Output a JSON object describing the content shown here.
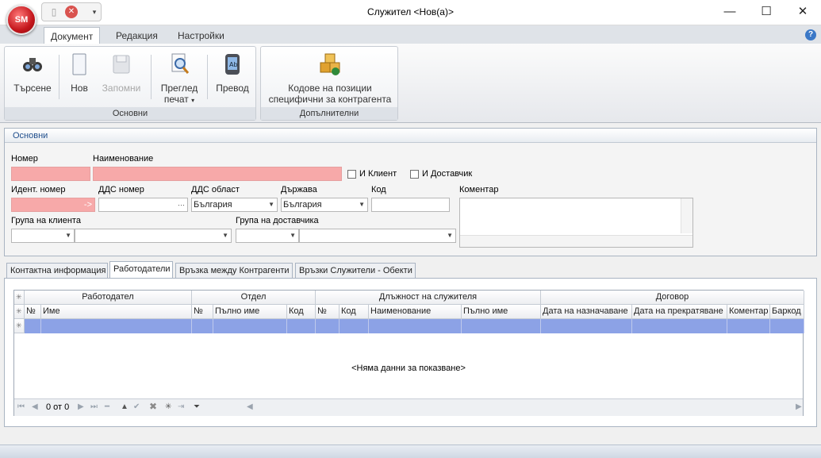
{
  "window": {
    "title": "Служител <Нов(а)>",
    "orb_label": "SM",
    "min_symbol": "—",
    "max_symbol": "☐",
    "close_symbol": "✕"
  },
  "ribbon": {
    "tabs": [
      "Документ",
      "Редакция",
      "Настройки"
    ],
    "active_tab": "Документ",
    "groups": {
      "main": {
        "caption": "Основни",
        "buttons": {
          "search": "Търсене",
          "new": "Нов",
          "save": "Запомни",
          "preview_line1": "Преглед",
          "preview_line2": "печат",
          "translate": "Превод"
        }
      },
      "extra": {
        "caption": "Допълнителни",
        "codes_line1": "Кодове на позиции",
        "codes_line2": "специфични за контрагента"
      }
    }
  },
  "main_panel": {
    "header": "Основни",
    "labels": {
      "number": "Номер",
      "name": "Наименование",
      "is_client": "И Клиент",
      "is_supplier": "И Доставчик",
      "ident": "Идент. номер",
      "vat_number": "ДДС номер",
      "vat_region": "ДДС област",
      "country": "Държава",
      "code": "Код",
      "comment": "Коментар",
      "client_group": "Група на клиента",
      "supplier_group": "Група на доставчика"
    },
    "values": {
      "ident_arrow": "->",
      "vat_number_ellipsis": "···",
      "vat_region": "България",
      "country": "България"
    }
  },
  "lower_tabs": [
    "Контактна информация",
    "Работодатели",
    "Връзка между Контрагенти",
    "Връзки Служители - Обекти"
  ],
  "active_lower_tab": "Работодатели",
  "grid": {
    "bands": [
      "Работодател",
      "Отдел",
      "Длъжност на служителя",
      "Договор"
    ],
    "columns": [
      "№",
      "Име",
      "№",
      "Пълно име",
      "Код",
      "№",
      "Код",
      "Наименование",
      "Пълно име",
      "Дата на назначаване",
      "Дата на прекратяване",
      "Коментар",
      "Баркод"
    ],
    "empty_text": "<Няма данни за показване>",
    "pager_text": "0 от 0"
  }
}
